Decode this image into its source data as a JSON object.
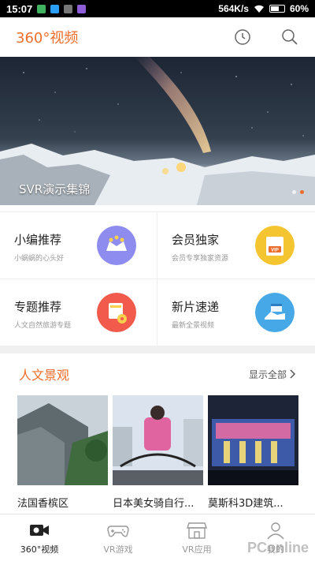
{
  "status_bar": {
    "time": "15:07",
    "network_speed": "564K/s",
    "battery": "60%"
  },
  "header": {
    "title": "360°视频",
    "history_icon": "clock-icon",
    "search_icon": "search-icon"
  },
  "banner": {
    "caption": "SVR演示集锦",
    "dots": 2,
    "active_dot": 1
  },
  "features": [
    {
      "title": "小编推荐",
      "subtitle": "小蜗蜗的心头好",
      "icon": "crown-stars-icon",
      "color": "#8f8cf0"
    },
    {
      "title": "会员独家",
      "subtitle": "会员专享独家资源",
      "icon": "vip-card-icon",
      "color": "#f4c531"
    },
    {
      "title": "专题推荐",
      "subtitle": "人文自然旅游专题",
      "icon": "film-reel-icon",
      "color": "#f25b4c"
    },
    {
      "title": "新片速递",
      "subtitle": "最新全景视频",
      "icon": "shoe-clapper-icon",
      "color": "#47a8e8"
    }
  ],
  "section": {
    "title": "人文景观",
    "more": "显示全部",
    "more_icon": "chevron-right-icon"
  },
  "videos": [
    {
      "label": "法国香槟区"
    },
    {
      "label": "日本美女骑自行..."
    },
    {
      "label": "莫斯科3D建筑..."
    }
  ],
  "bottom_nav": [
    {
      "label": "360°视频",
      "icon": "video-camera-icon",
      "active": true
    },
    {
      "label": "VR游戏",
      "icon": "gamepad-icon",
      "active": false
    },
    {
      "label": "VR应用",
      "icon": "store-icon",
      "active": false
    },
    {
      "label": "我的",
      "icon": "user-icon",
      "active": false
    }
  ],
  "watermark": "PConline",
  "colors": {
    "accent": "#ef6d2c"
  }
}
